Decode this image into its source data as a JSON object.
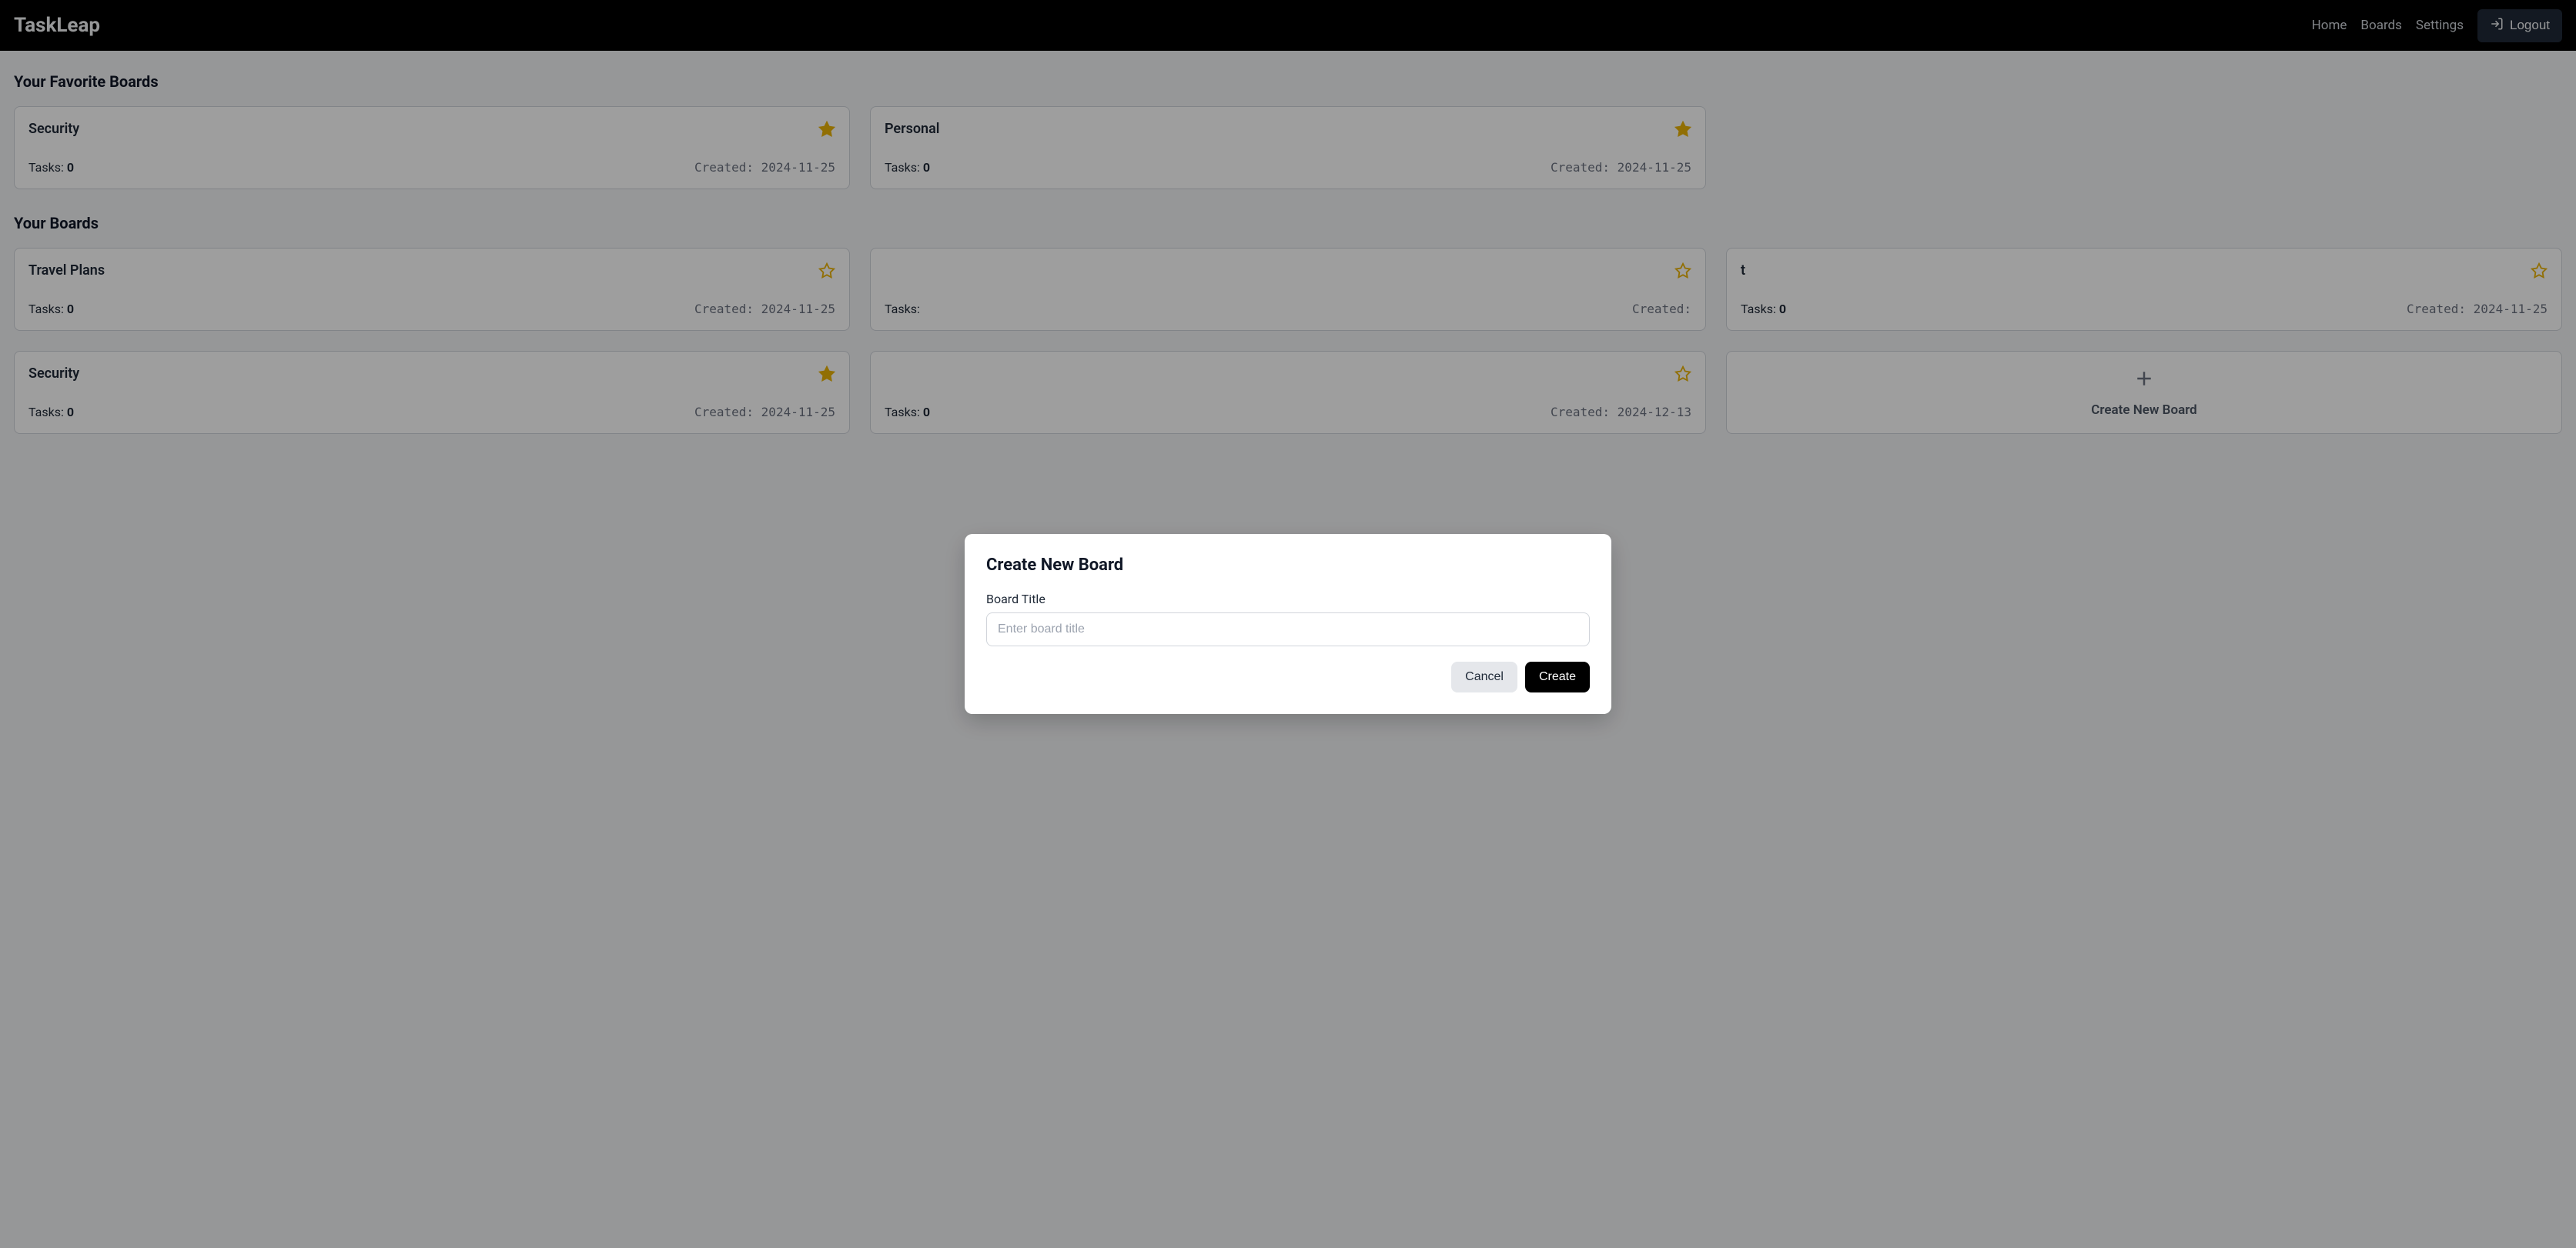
{
  "brand": "TaskLeap",
  "nav": {
    "home": "Home",
    "boards": "Boards",
    "settings": "Settings",
    "logout": "Logout"
  },
  "sections": {
    "favorites_title": "Your Favorite Boards",
    "boards_title": "Your Boards"
  },
  "labels": {
    "tasks_prefix": "Tasks: ",
    "created_prefix": "Created: "
  },
  "favorites": [
    {
      "title": "Security",
      "tasks": "0",
      "created": "2024-11-25",
      "starred": true
    },
    {
      "title": "Personal",
      "tasks": "0",
      "created": "2024-11-25",
      "starred": true
    }
  ],
  "boards": [
    {
      "title": "Travel Plans",
      "tasks": "0",
      "created": "2024-11-25",
      "starred": false
    },
    {
      "title": "",
      "tasks": "",
      "created": "",
      "starred": false
    },
    {
      "title": "t",
      "tasks": "0",
      "created": "2024-11-25",
      "starred": false
    },
    {
      "title": "Security",
      "tasks": "0",
      "created": "2024-11-25",
      "starred": true
    },
    {
      "title": "",
      "tasks": "0",
      "created": "2024-12-13",
      "starred": false
    }
  ],
  "create_tile": {
    "label": "Create New Board"
  },
  "modal": {
    "title": "Create New Board",
    "field_label": "Board Title",
    "placeholder": "Enter board title",
    "cancel": "Cancel",
    "create": "Create"
  }
}
